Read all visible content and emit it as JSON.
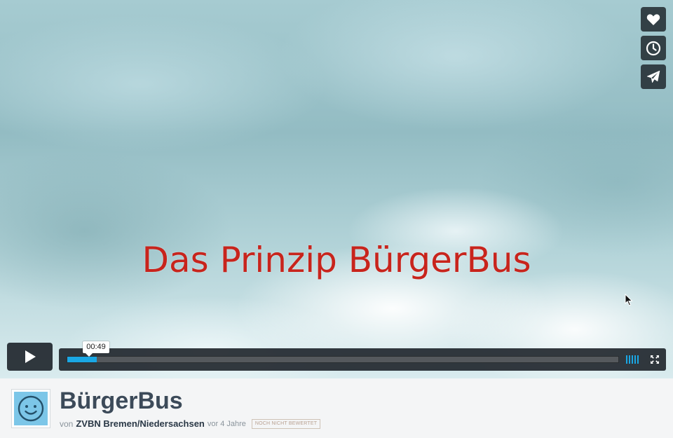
{
  "video": {
    "overlay_text": "Das Prinzip BürgerBus",
    "title_color": "#c8241c"
  },
  "side_actions": [
    {
      "icon": "heart-icon",
      "name": "like"
    },
    {
      "icon": "clock-icon",
      "name": "watch-later"
    },
    {
      "icon": "paper-plane-icon",
      "name": "share"
    }
  ],
  "controls": {
    "play_icon": "play-icon",
    "time_tooltip": "00:49",
    "progress_played_fraction": 0.054,
    "progress_loaded_fraction": 0.054,
    "accent_color": "#1aa7e4",
    "volume_bars": 5,
    "fullscreen_icon": "fullscreen-icon"
  },
  "info": {
    "title": "BürgerBus",
    "by_prefix": "von",
    "owner": "ZVBN Bremen/Niedersachsen",
    "ago": "vor 4 Jahre",
    "rating_badge": "NOCH NICHT BEWERTET",
    "avatar_icon": "smiley-avatar-icon"
  }
}
